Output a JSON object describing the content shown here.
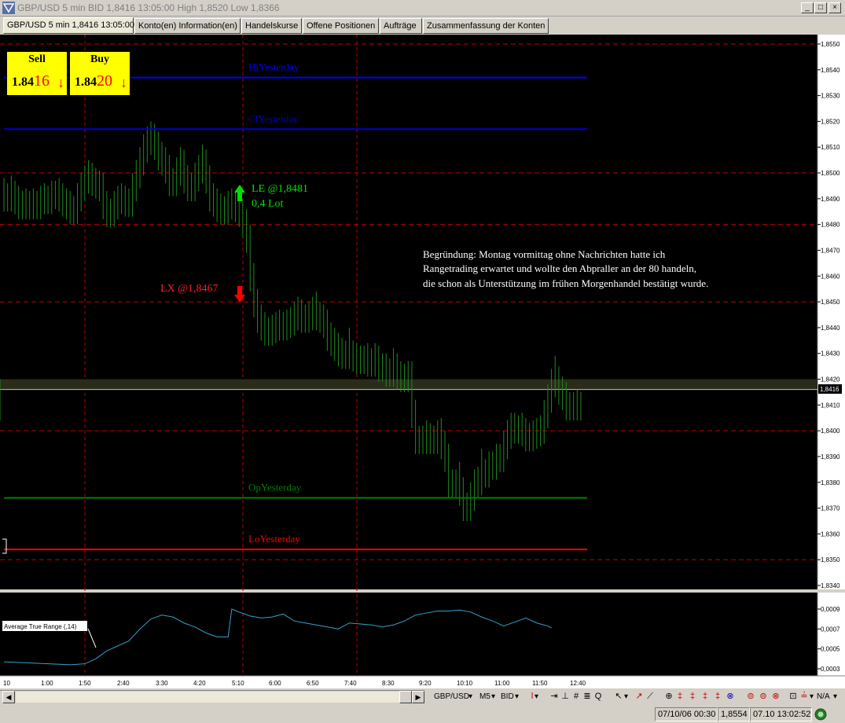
{
  "window": {
    "title": "GBP/USD 5 min BID 1,8416 13:05:00 High 1,8520 Low 1,8366",
    "controls": [
      "_",
      "□",
      "×"
    ]
  },
  "tabs": [
    {
      "label": "GBP/USD 5 min 1,8416 13:05:00",
      "active": true
    },
    {
      "label": "Konto(en) Information(en)"
    },
    {
      "label": "Handelskurse"
    },
    {
      "label": "Offene Positionen"
    },
    {
      "label": "Aufträge"
    },
    {
      "label": "Zusammenfassung der Konten"
    }
  ],
  "quote_panel": {
    "sell": {
      "label": "Sell",
      "price_prefix": "1.84",
      "price_suffix": "16",
      "arrow": "↓"
    },
    "buy": {
      "label": "Buy",
      "price_prefix": "1.84",
      "price_suffix": "20",
      "arrow": "↓"
    },
    "color": "#ffff00"
  },
  "chart_data": [
    {
      "type": "line",
      "title": "",
      "instrument": "GBP/USD",
      "interval": "5 min",
      "ylim": [
        1.834,
        1.855
      ],
      "y_ticks": [
        "1,8550",
        "1,8540",
        "1,8530",
        "1,8520",
        "1,8510",
        "1,8500",
        "1,8490",
        "1,8480",
        "1,8470",
        "1,8460",
        "1,8450",
        "1,8440",
        "1,8430",
        "1,8420",
        "1,8410",
        "1,8400",
        "1,8390",
        "1,8380",
        "1,8370",
        "1,8360",
        "1,8350",
        "1,8340"
      ],
      "last_price_label": "1,8416",
      "x_ticks": [
        "10",
        "1:00",
        "1:50",
        "2:40",
        "3:30",
        "4:20",
        "5:10",
        "6:00",
        "6:50",
        "7:40",
        "8:30",
        "9:20",
        "10:10",
        "11:00",
        "11:50",
        "12:40"
      ],
      "x_values": [
        0,
        5,
        10,
        15,
        20,
        25,
        30,
        35,
        40,
        45,
        50,
        55,
        60,
        65,
        70,
        75,
        80,
        85,
        90,
        95,
        100,
        105,
        110,
        115,
        120,
        125,
        130,
        135,
        140,
        145,
        150,
        155,
        160,
        165,
        170,
        175,
        180,
        185,
        190,
        195,
        200,
        205,
        210,
        215,
        220,
        225,
        230,
        235,
        240,
        245,
        250,
        255,
        260,
        265,
        270,
        275,
        280,
        285,
        290,
        295,
        300,
        305,
        310,
        315,
        320,
        325,
        330,
        335,
        340,
        345,
        350,
        355,
        360,
        365,
        370,
        375,
        380,
        385,
        390,
        395,
        400,
        405,
        410,
        415,
        420,
        425,
        430,
        435,
        440,
        445,
        450,
        455,
        460,
        465,
        470,
        475,
        480,
        485,
        490,
        495,
        500,
        505,
        510,
        515,
        520,
        525,
        530,
        535,
        540,
        545,
        550,
        555,
        560,
        565,
        570,
        575,
        580,
        585,
        590,
        595,
        600,
        605,
        610,
        615,
        620,
        625,
        630,
        635,
        640,
        645,
        650,
        655,
        660,
        665,
        670,
        675,
        680,
        685,
        690,
        695,
        700,
        705,
        710,
        715,
        720,
        725,
        730,
        735,
        740,
        745,
        750,
        755,
        760,
        765,
        770,
        775,
        780,
        785
      ],
      "series": [
        {
          "color": "#1e8c1e",
          "high": [
            1.8498,
            1.8496,
            1.8499,
            1.8497,
            1.8495,
            1.8493,
            1.8494,
            1.8493,
            1.8494,
            1.8493,
            1.8495,
            1.8496,
            1.8495,
            1.8497,
            1.8497,
            1.8498,
            1.8496,
            1.8494,
            1.8493,
            1.8491,
            1.8496,
            1.85,
            1.8503,
            1.8505,
            1.8504,
            1.8502,
            1.8501,
            1.85,
            1.8493,
            1.849,
            1.8493,
            1.8495,
            1.8496,
            1.8495,
            1.8494,
            1.85,
            1.8505,
            1.851,
            1.8515,
            1.8518,
            1.852,
            1.8519,
            1.8516,
            1.8512,
            1.851,
            1.8507,
            1.8502,
            1.8506,
            1.851,
            1.8509,
            1.8503,
            1.85,
            1.8504,
            1.8507,
            1.8511,
            1.8509,
            1.8503,
            1.8496,
            1.8494,
            1.8492,
            1.8491,
            1.8493,
            1.8494,
            1.8493,
            1.8492,
            1.849,
            1.8486,
            1.848,
            1.8465,
            1.8455,
            1.8449,
            1.8446,
            1.8444,
            1.8445,
            1.8446,
            1.8447,
            1.8446,
            1.8447,
            1.8448,
            1.845,
            1.8452,
            1.8451,
            1.8449,
            1.845,
            1.8452,
            1.8454,
            1.845,
            1.8449,
            1.8447,
            1.8442,
            1.844,
            1.8438,
            1.8436,
            1.8435,
            1.844,
            1.8435,
            1.8434,
            1.8433,
            1.8433,
            1.8434,
            1.8432,
            1.8434,
            1.8433,
            1.843,
            1.843,
            1.8428,
            1.8432,
            1.843,
            1.8427,
            1.8426,
            1.8427,
            1.8427,
            1.8412,
            1.8402,
            1.8402,
            1.8404,
            1.8403,
            1.8402,
            1.8404,
            1.8405,
            1.84,
            1.8395,
            1.8385,
            1.8385,
            1.8388,
            1.8382,
            1.8376,
            1.838,
            1.8385,
            1.8386,
            1.8393,
            1.8389,
            1.8392,
            1.8392,
            1.8395,
            1.8395,
            1.84,
            1.8404,
            1.8407,
            1.8407,
            1.8406,
            1.8407,
            1.8405,
            1.8403,
            1.8404,
            1.8405,
            1.8406,
            1.8412,
            1.8418,
            1.8424,
            1.8429,
            1.8425,
            1.8421,
            1.8419,
            1.8415,
            1.8415,
            1.8416,
            1.8415,
            1.842
          ]
        }
      ]
    },
    {
      "type": "line",
      "title": "Average True Range (,14)",
      "ylim": [
        0.0002,
        0.001
      ],
      "y_ticks": [
        "0,0009",
        "0,0007",
        "0,0005",
        "0,0003"
      ],
      "x_values": [
        0,
        30,
        60,
        90,
        110,
        125,
        140,
        155,
        170,
        185,
        200,
        215,
        230,
        245,
        260,
        275,
        290,
        305,
        310,
        320,
        335,
        350,
        365,
        380,
        395,
        410,
        425,
        440,
        455,
        470,
        485,
        500,
        515,
        530,
        545,
        560,
        575,
        590,
        605,
        620,
        635,
        650,
        665,
        680,
        695,
        710,
        725,
        740,
        745
      ],
      "series": [
        {
          "color": "#36a0c8",
          "values": [
            0.00037,
            0.00036,
            0.00035,
            0.00034,
            0.00035,
            0.0004,
            0.00048,
            0.00053,
            0.00058,
            0.0007,
            0.0008,
            0.00084,
            0.00082,
            0.00076,
            0.00072,
            0.00066,
            0.00062,
            0.00062,
            0.0009,
            0.00087,
            0.00083,
            0.00081,
            0.00082,
            0.00085,
            0.00078,
            0.00076,
            0.00074,
            0.00072,
            0.0007,
            0.00076,
            0.00075,
            0.00074,
            0.00072,
            0.00074,
            0.00078,
            0.00084,
            0.00086,
            0.00088,
            0.00088,
            0.00089,
            0.00087,
            0.00082,
            0.00078,
            0.00073,
            0.00077,
            0.00081,
            0.00076,
            0.00073,
            0.00071
          ]
        }
      ]
    }
  ],
  "levels": [
    {
      "label": "HiYesterday",
      "value": 1.8537,
      "color": "#0000ff"
    },
    {
      "label": "ClYesterday",
      "value": 1.8517,
      "color": "#0000cc"
    },
    {
      "label": "OpYesterday",
      "value": 1.8374,
      "color": "#008000"
    },
    {
      "label": "LoYesterday",
      "value": 1.8354,
      "color": "#ff0000"
    }
  ],
  "trades": {
    "entry": {
      "label": "LE @1,8481",
      "lot": "0,4 Lot",
      "price": 1.8481,
      "color": "#00e000"
    },
    "exit": {
      "label": "LX @1,8467",
      "price": 1.8467,
      "color": "#ff0000"
    }
  },
  "annotation": {
    "lines": [
      "Begründung: Montag vormittag ohne Nachrichten hatte ich",
      "Rangetrading erwartet und wollte den Abpraller an der 80 handeln,",
      "die schon als Unterstützung im frühen Morgenhandel bestätigt wurde."
    ]
  },
  "toolbar": {
    "symbol": "GBP/USD",
    "interval": "M5",
    "side": "BID",
    "na": "N/A"
  },
  "status": {
    "date_price": "07/10/06 00:30",
    "price": "1,8554",
    "time": "07.10 13:02:52"
  }
}
